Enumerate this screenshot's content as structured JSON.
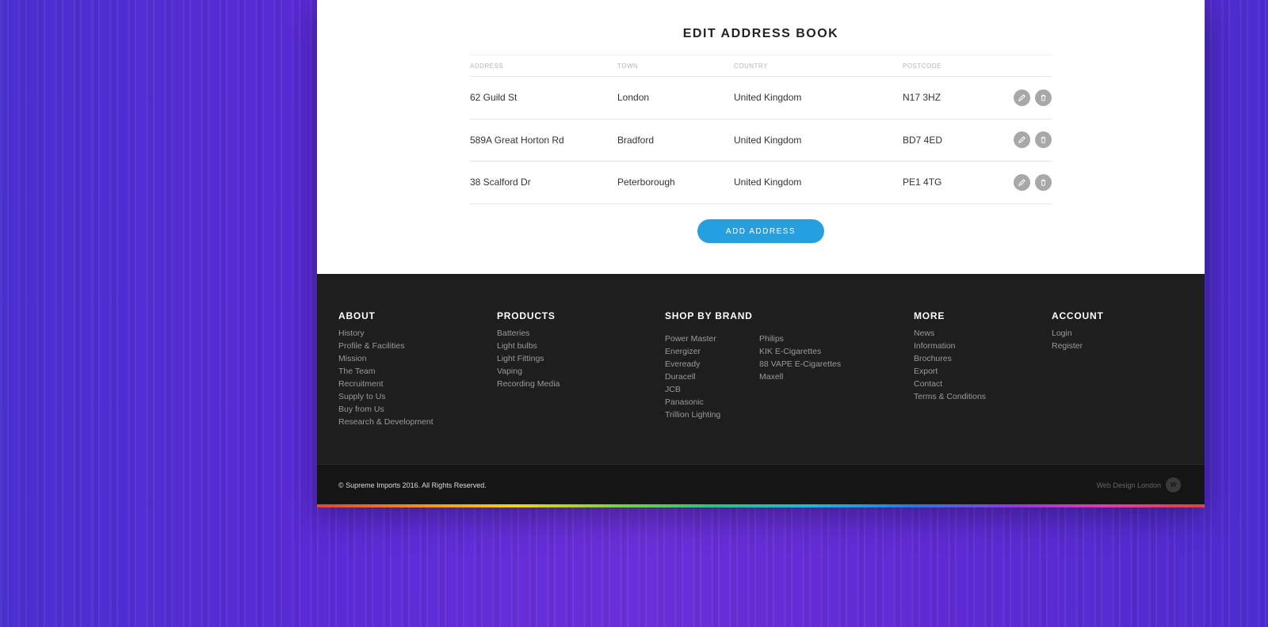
{
  "page": {
    "title": "EDIT ADDRESS BOOK",
    "add_button_label": "ADD ADDRESS"
  },
  "table": {
    "headers": [
      "ADDRESS",
      "TOWN",
      "COUNTRY",
      "POSTCODE"
    ],
    "rows": [
      {
        "address": "62 Guild St",
        "town": "London",
        "country": "United Kingdom",
        "postcode": "N17 3HZ"
      },
      {
        "address": "589A Great Horton Rd",
        "town": "Bradford",
        "country": "United Kingdom",
        "postcode": "BD7 4ED"
      },
      {
        "address": "38 Scalford Dr",
        "town": "Peterborough",
        "country": "United Kingdom",
        "postcode": "PE1 4TG"
      }
    ],
    "action_icons": [
      "pencil-icon",
      "trash-icon"
    ]
  },
  "footer": {
    "about": {
      "heading": "ABOUT",
      "links": [
        "History",
        "Profile & Facilities",
        "Mission",
        "The Team",
        "Recruitment",
        "Supply to Us",
        "Buy from Us",
        "Research & Development"
      ]
    },
    "products": {
      "heading": "PRODUCTS",
      "links": [
        "Batteries",
        "Light bulbs",
        "Light Fittings",
        "Vaping",
        "Recording Media"
      ]
    },
    "brands": {
      "heading": "SHOP BY BRAND",
      "col1": [
        "Power Master",
        "Energizer",
        "Eveready",
        "Duracell",
        "JCB",
        "Panasonic",
        "Trillion Lighting"
      ],
      "col2": [
        "Philips",
        "KIK E-Cigarettes",
        "88 VAPE E-Cigarettes",
        "Maxell"
      ]
    },
    "more": {
      "heading": "MORE",
      "links": [
        "News",
        "Information",
        "Brochures",
        "Export",
        "Contact",
        "Terms & Conditions"
      ]
    },
    "account": {
      "heading": "ACCOUNT",
      "links": [
        "Login",
        "Register"
      ]
    },
    "copyright": "© Supreme Imports 2016. All Rights Reserved.",
    "credit": "Web Design London",
    "credit_logo": "W"
  },
  "colors": {
    "accent": "#269fe0",
    "footer_bg": "#1e1e1e",
    "icon_bg": "#a8a8a8"
  }
}
